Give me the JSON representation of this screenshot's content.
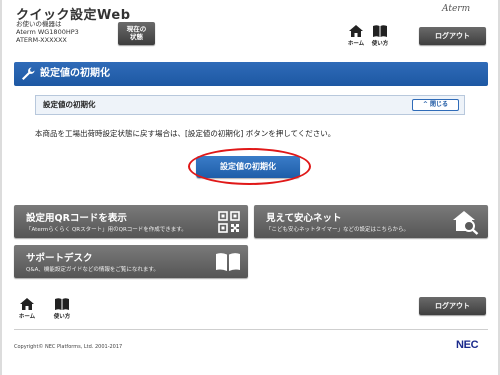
{
  "header": {
    "app_title": "クイック設定Web",
    "device_line1": "お使いの機器は",
    "device_line2": "Aterm WG1800HP3",
    "device_line3": "ATERM-XXXXXX",
    "status_button_line1": "現在の",
    "status_button_line2": "状態",
    "brand": "Aterm",
    "home_label": "ホーム",
    "manual_label": "使い方",
    "logout_label": "ログアウト"
  },
  "section": {
    "title": "設定値の初期化",
    "panel_title": "設定値の初期化",
    "close_label": "閉じる",
    "description": "本商品を工場出荷時設定状態に戻す場合は、[設定値の初期化] ボタンを押してください。",
    "reset_button_label": "設定値の初期化"
  },
  "cards": {
    "qr": {
      "title": "設定用QRコードを表示",
      "subtitle": "「Atermらくらく QRスタート」用のQRコードを作成できます。"
    },
    "security": {
      "title": "見えて安心ネット",
      "subtitle": "「こども安心ネットタイマー」などの設定はこちらから。"
    },
    "support": {
      "title": "サポートデスク",
      "subtitle": "Q&A、機能設定ガイドなどの情報をご覧になれます。"
    }
  },
  "footer": {
    "home_label": "ホーム",
    "manual_label": "使い方",
    "logout_label": "ログアウト",
    "copyright": "Copyright© NEC Platforms, Ltd. 2001-2017",
    "brand": "NEC"
  },
  "colors": {
    "primary_blue": "#1d58a3",
    "highlight_red": "#e01818",
    "card_gray": "#616161",
    "nec_blue": "#1a2a8c"
  }
}
